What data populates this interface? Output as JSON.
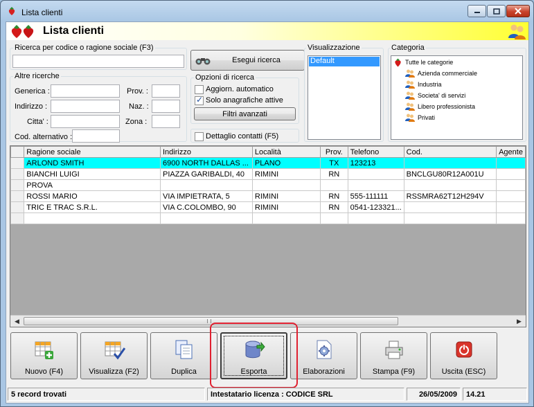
{
  "window": {
    "title": "Lista clienti"
  },
  "header": {
    "title": "Lista clienti"
  },
  "search": {
    "group_label": "Ricerca per codice o ragione sociale (F3)",
    "value": "",
    "button_label": "Esegui ricerca"
  },
  "other_searches": {
    "group_label": "Altre ricerche",
    "generica_label": "Generica :",
    "indirizzo_label": "Indirizzo :",
    "citta_label": "Citta' :",
    "cod_alternativo_label": "Cod. alternativo :",
    "prov_label": "Prov. :",
    "naz_label": "Naz. :",
    "zona_label": "Zona :"
  },
  "search_options": {
    "group_label": "Opzioni di ricerca",
    "aggiorn_label": "Aggiorn. automatico",
    "aggiorn_checked": false,
    "solo_label": "Solo anagrafiche attive",
    "solo_checked": true,
    "filtri_label": "Filtri avanzati",
    "dettaglio_label": "Dettaglio contatti (F5)",
    "dettaglio_checked": false
  },
  "visualizzazione": {
    "group_label": "Visualizzazione",
    "items": [
      "Default"
    ],
    "selected": "Default"
  },
  "categoria": {
    "group_label": "Categoria",
    "root": "Tutte le categorie",
    "items": [
      "Azienda commerciale",
      "Industria",
      "Societa' di servizi",
      "Libero professionista",
      "Privati"
    ]
  },
  "grid": {
    "columns": [
      "Ragione sociale",
      "Indirizzo",
      "Località",
      "Prov.",
      "Telefono",
      "Cod.",
      "Agente"
    ],
    "rows": [
      [
        "ARLOND SMITH",
        "6900 NORTH DALLAS ...",
        "PLANO",
        "TX",
        "123213",
        "",
        ""
      ],
      [
        "BIANCHI LUIGI",
        "PIAZZA GARIBALDI, 40",
        "RIMINI",
        "RN",
        "",
        "BNCLGU80R12A001U",
        ""
      ],
      [
        "PROVA",
        "",
        "",
        "",
        "",
        "",
        ""
      ],
      [
        "ROSSI MARIO",
        "VIA IMPIETRATA, 5",
        "RIMINI",
        "RN",
        "555-111111",
        "RSSMRA62T12H294V",
        ""
      ],
      [
        "TRIC E TRAC S.R.L.",
        "VIA C.COLOMBO, 90",
        "RIMINI",
        "RN",
        "0541-123321...",
        "",
        ""
      ]
    ],
    "selected_row": 0
  },
  "toolbar": {
    "nuovo": "Nuovo (F4)",
    "visualizza": "Visualizza (F2)",
    "duplica": "Duplica",
    "esporta": "Esporta",
    "elaborazioni": "Elaborazioni",
    "stampa": "Stampa (F9)",
    "uscita": "Uscita (ESC)"
  },
  "status": {
    "records": "5 record trovati",
    "licenza": "Intestatario licenza : CODICE SRL",
    "date": "26/05/2009",
    "time": "14.21"
  },
  "colors": {
    "selected_row": "#00ffff",
    "header_gradient_end": "#ffff33",
    "highlight": "#e02030"
  }
}
